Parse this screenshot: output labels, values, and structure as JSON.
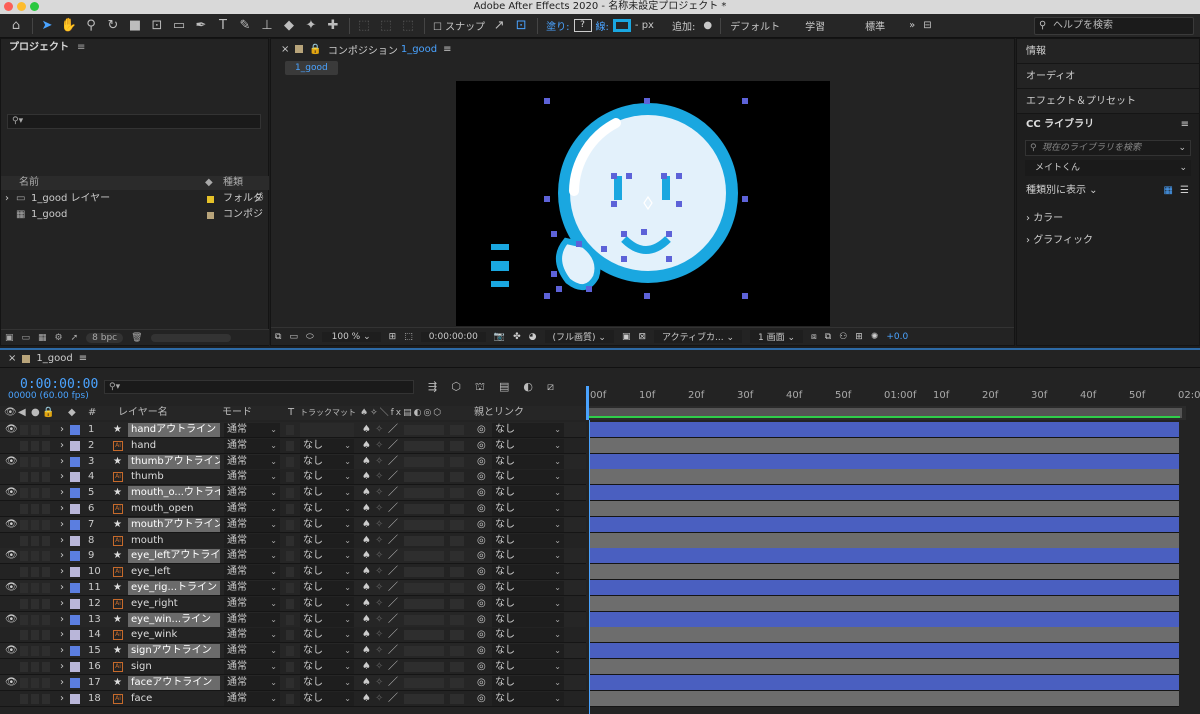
{
  "window": {
    "title": "Adobe After Effects 2020 - 名称未設定プロジェクト *"
  },
  "toolbar": {
    "snap_label": "スナップ",
    "fill_label": "塗り:",
    "fill_value": "?",
    "stroke_label": "線:",
    "px_label": "- px",
    "add_label": "追加:",
    "workspaces": [
      "デフォルト",
      "学習",
      "標準"
    ],
    "help_placeholder": "ヘルプを検索"
  },
  "project": {
    "title": "プロジェクト",
    "col_name": "名前",
    "col_type": "種類",
    "items": [
      {
        "name": "1_good レイヤー",
        "type": "フォルダ",
        "color": "#e6c229"
      },
      {
        "name": "1_good",
        "type": "コンポジ",
        "color": "#b8a47a"
      }
    ],
    "bpc": "8 bpc"
  },
  "composition": {
    "tab_label": "コンポジション",
    "tab_name": "1_good",
    "sub_tab": "1_good",
    "zoom": "100 %",
    "time": "0:00:00:00",
    "quality": "(フル画質)",
    "camera": "アクティブカ...",
    "views": "1 画面",
    "exposure": "+0.0"
  },
  "right_panels": {
    "items": [
      "情報",
      "オーディオ",
      "エフェクト＆プリセット"
    ],
    "library_title": "CC ライブラリ",
    "library_search": "現在のライブラリを検索",
    "library_select": "メイトくん",
    "view_by": "種類別に表示",
    "sections": [
      "カラー",
      "グラフィック"
    ]
  },
  "timeline": {
    "comp_tab": "1_good",
    "timecode": "0:00:00:00",
    "fps": "00000 (60.00 fps)",
    "col_layer_name": "レイヤー名",
    "col_mode": "モード",
    "col_t": "T",
    "col_trackmatte": "トラックマット",
    "col_parent": "親とリンク",
    "ruler_ticks": [
      "00f",
      "10f",
      "20f",
      "30f",
      "40f",
      "50f",
      "01:00f",
      "10f",
      "20f",
      "30f",
      "40f",
      "50f",
      "02:0"
    ],
    "layers": [
      {
        "num": "1",
        "name": "handアウトライン",
        "mode": "通常",
        "matte": "",
        "parent": "なし",
        "shape": true,
        "color": "#5b7ee0"
      },
      {
        "num": "2",
        "name": "hand",
        "mode": "通常",
        "matte": "なし",
        "parent": "なし",
        "shape": false,
        "color": "#b9b6d9"
      },
      {
        "num": "3",
        "name": "thumbアウトライン",
        "mode": "通常",
        "matte": "なし",
        "parent": "なし",
        "shape": true,
        "color": "#5b7ee0"
      },
      {
        "num": "4",
        "name": "thumb",
        "mode": "通常",
        "matte": "なし",
        "parent": "なし",
        "shape": false,
        "color": "#b9b6d9"
      },
      {
        "num": "5",
        "name": "mouth_o...ウトライン",
        "mode": "通常",
        "matte": "なし",
        "parent": "なし",
        "shape": true,
        "color": "#5b7ee0"
      },
      {
        "num": "6",
        "name": "mouth_open",
        "mode": "通常",
        "matte": "なし",
        "parent": "なし",
        "shape": false,
        "color": "#b9b6d9"
      },
      {
        "num": "7",
        "name": "mouthアウトライン",
        "mode": "通常",
        "matte": "なし",
        "parent": "なし",
        "shape": true,
        "color": "#5b7ee0"
      },
      {
        "num": "8",
        "name": "mouth",
        "mode": "通常",
        "matte": "なし",
        "parent": "なし",
        "shape": false,
        "color": "#b9b6d9"
      },
      {
        "num": "9",
        "name": "eye_leftアウトライン",
        "mode": "通常",
        "matte": "なし",
        "parent": "なし",
        "shape": true,
        "color": "#5b7ee0"
      },
      {
        "num": "10",
        "name": "eye_left",
        "mode": "通常",
        "matte": "なし",
        "parent": "なし",
        "shape": false,
        "color": "#b9b6d9"
      },
      {
        "num": "11",
        "name": "eye_rig...トライン",
        "mode": "通常",
        "matte": "なし",
        "parent": "なし",
        "shape": true,
        "color": "#5b7ee0"
      },
      {
        "num": "12",
        "name": "eye_right",
        "mode": "通常",
        "matte": "なし",
        "parent": "なし",
        "shape": false,
        "color": "#b9b6d9"
      },
      {
        "num": "13",
        "name": "eye_win...ライン",
        "mode": "通常",
        "matte": "なし",
        "parent": "なし",
        "shape": true,
        "color": "#5b7ee0"
      },
      {
        "num": "14",
        "name": "eye_wink",
        "mode": "通常",
        "matte": "なし",
        "parent": "なし",
        "shape": false,
        "color": "#b9b6d9"
      },
      {
        "num": "15",
        "name": "signアウトライン",
        "mode": "通常",
        "matte": "なし",
        "parent": "なし",
        "shape": true,
        "color": "#5b7ee0"
      },
      {
        "num": "16",
        "name": "sign",
        "mode": "通常",
        "matte": "なし",
        "parent": "なし",
        "shape": false,
        "color": "#b9b6d9"
      },
      {
        "num": "17",
        "name": "faceアウトライン",
        "mode": "通常",
        "matte": "なし",
        "parent": "なし",
        "shape": true,
        "color": "#5b7ee0"
      },
      {
        "num": "18",
        "name": "face",
        "mode": "通常",
        "matte": "なし",
        "parent": "なし",
        "shape": false,
        "color": "#b9b6d9"
      }
    ]
  },
  "colors": {
    "accent": "#4aa3ff",
    "shape_bar": "#4a5fc0",
    "footage_bar": "#6d6d6d",
    "artwork": "#1aa7e0"
  }
}
